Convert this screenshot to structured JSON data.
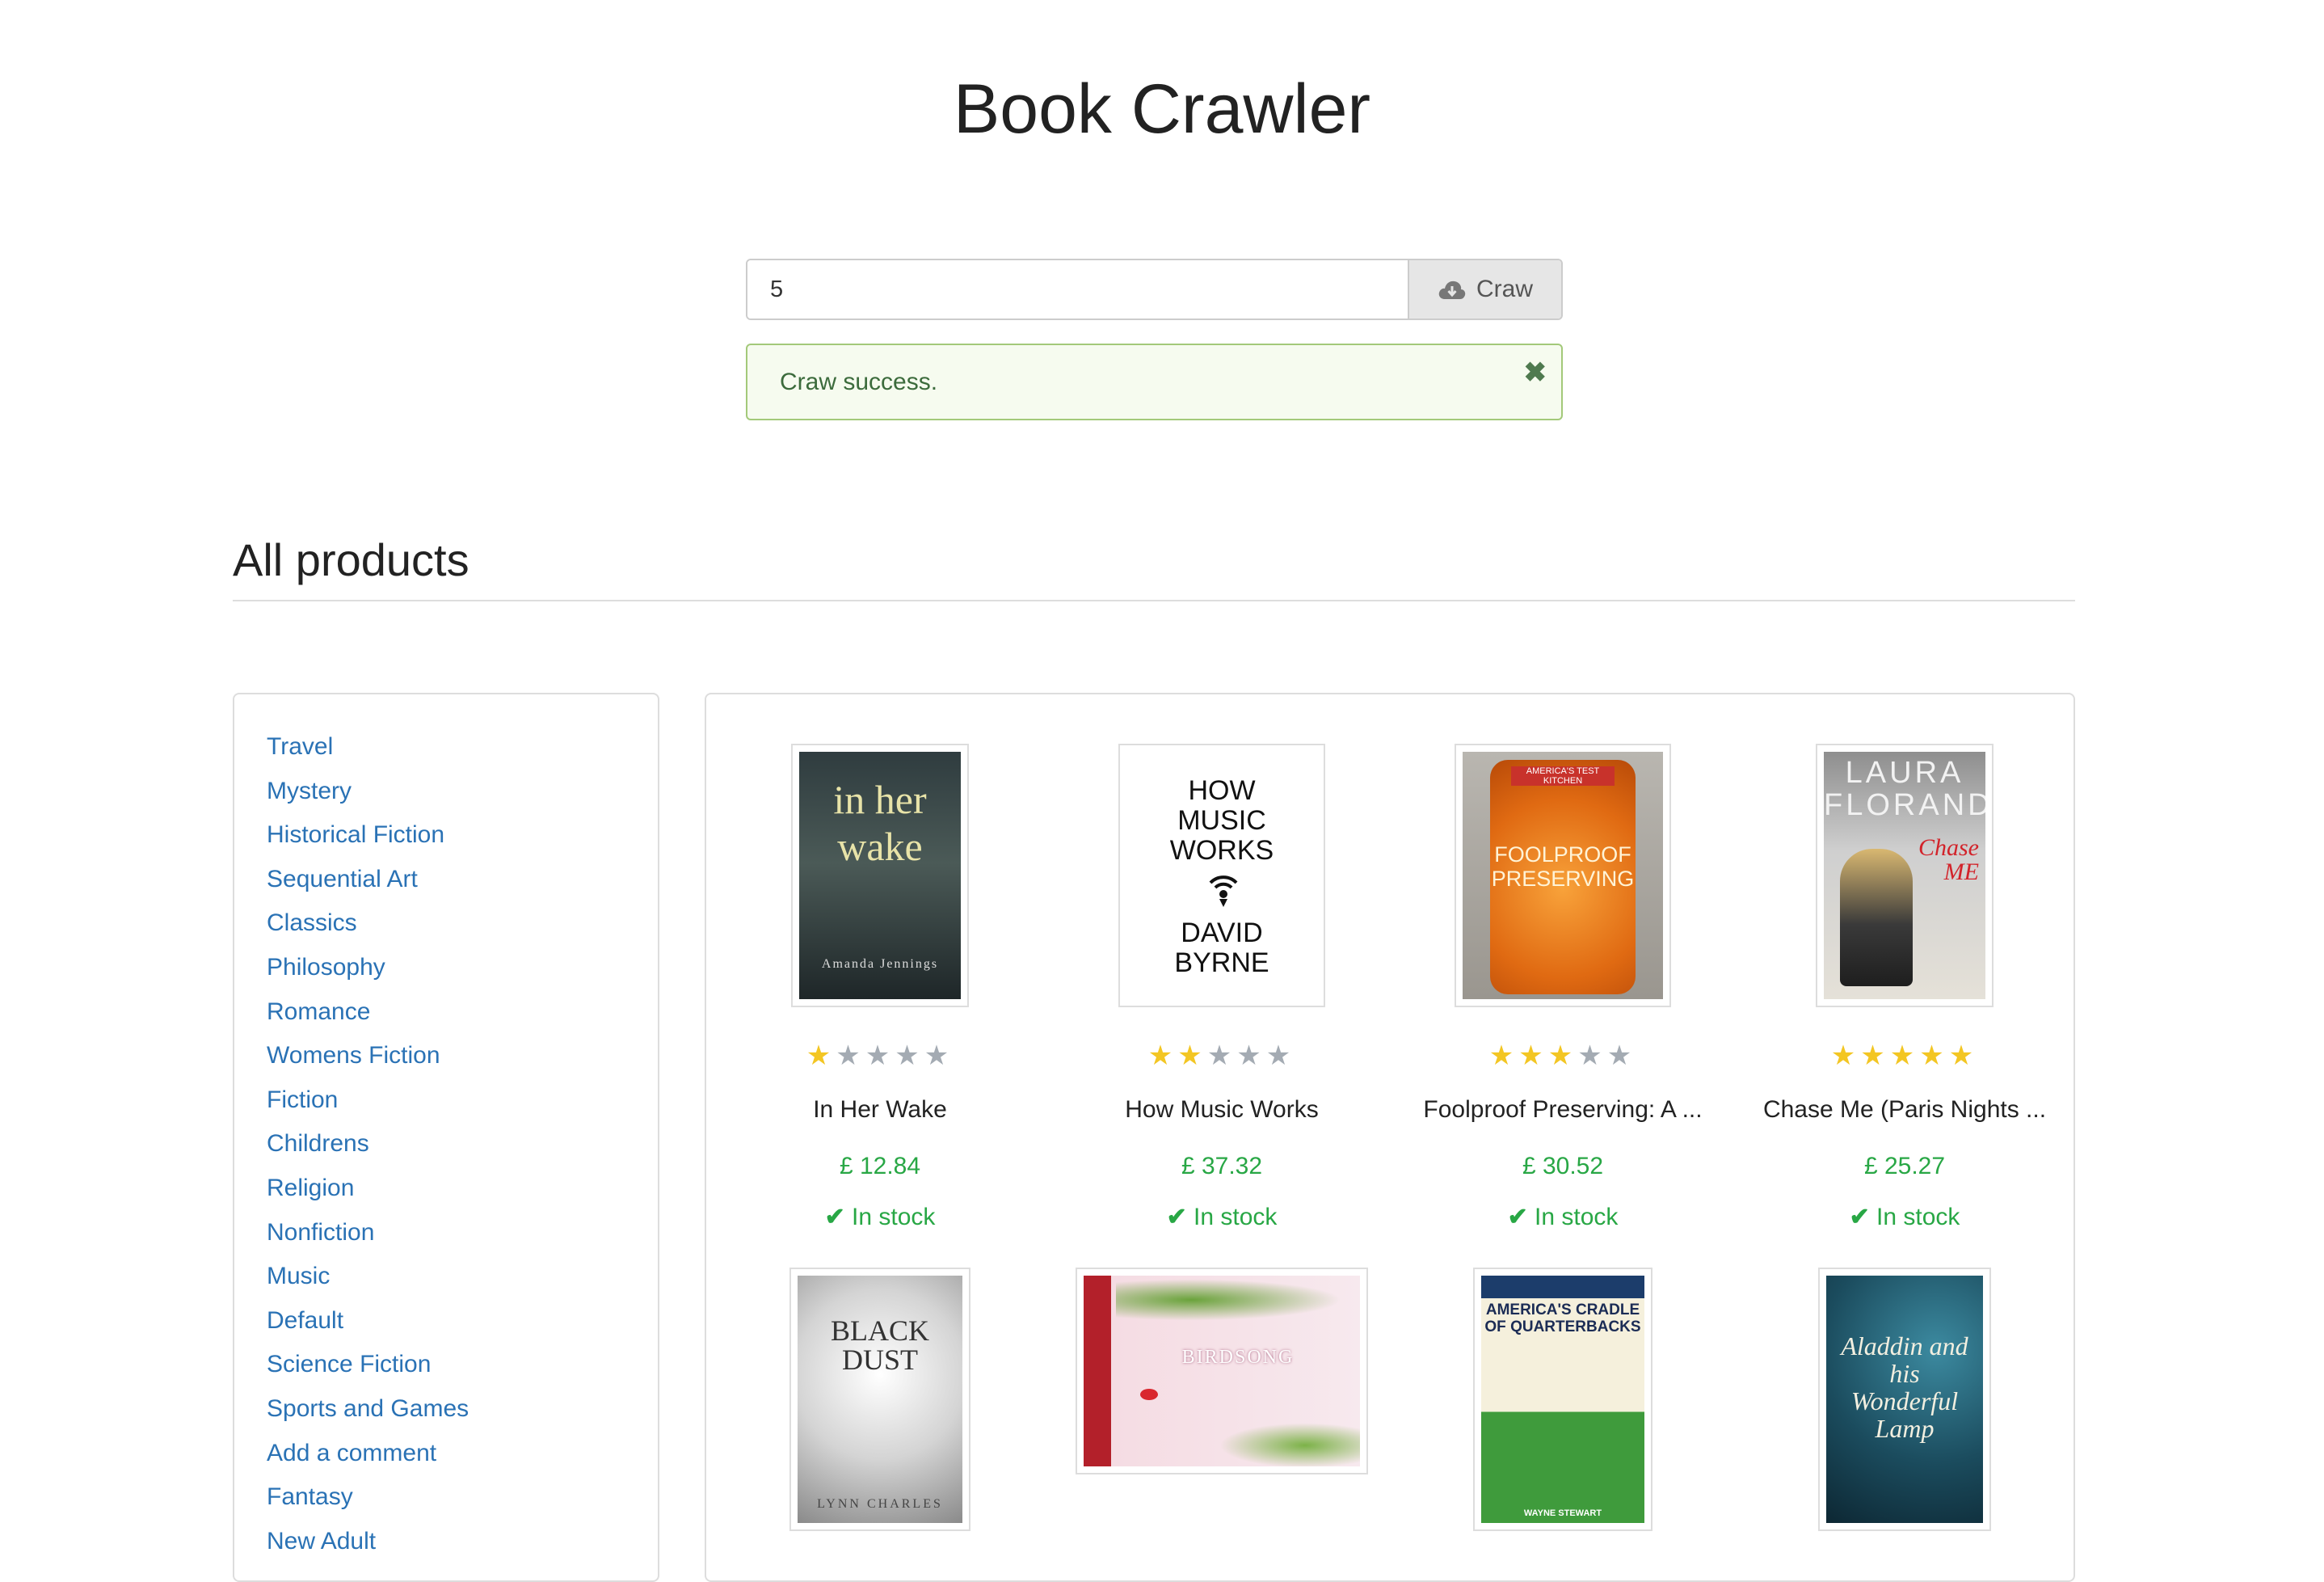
{
  "header": {
    "title": "Book Crawler"
  },
  "crawl": {
    "value": "5",
    "button_label": "Craw",
    "button_icon": "cloud-download-icon"
  },
  "alert": {
    "message": "Craw success.",
    "close_glyph": "✖"
  },
  "section": {
    "title": "All products"
  },
  "categories": [
    "Travel",
    "Mystery",
    "Historical Fiction",
    "Sequential Art",
    "Classics",
    "Philosophy",
    "Romance",
    "Womens Fiction",
    "Fiction",
    "Childrens",
    "Religion",
    "Nonfiction",
    "Music",
    "Default",
    "Science Fiction",
    "Sports and Games",
    "Add a comment",
    "Fantasy",
    "New Adult"
  ],
  "products": [
    {
      "name": "In Her Wake",
      "price": "£ 12.84",
      "stock": "In stock",
      "rating": 1,
      "cover_title": "in her wake",
      "cover_author": "Amanda Jennings"
    },
    {
      "name": "How Music Works",
      "price": "£ 37.32",
      "stock": "In stock",
      "rating": 2,
      "cover_title": "HOW MUSIC WORKS",
      "cover_author": "DAVID BYRNE"
    },
    {
      "name": "Foolproof Preserving: A ...",
      "price": "£ 30.52",
      "stock": "In stock",
      "rating": 3,
      "cover_title": "FOOLPROOF PRESERVING",
      "cover_author": "AMERICA'S TEST KITCHEN"
    },
    {
      "name": "Chase Me (Paris Nights ...",
      "price": "£ 25.27",
      "stock": "In stock",
      "rating": 5,
      "cover_title": "Chase ME",
      "cover_author": "LAURA FLORAND"
    }
  ],
  "products_row2": [
    {
      "cover_title": "BLACK DUST",
      "cover_author": "LYNN CHARLES"
    },
    {
      "cover_title": "BIRDSONG",
      "cover_author": ""
    },
    {
      "cover_title": "AMERICA'S CRADLE OF QUARTERBACKS",
      "cover_author": "WAYNE STEWART"
    },
    {
      "cover_title": "Aladdin and his Wonderful Lamp",
      "cover_author": ""
    }
  ],
  "colors": {
    "link": "#2a72b5",
    "price": "#28a745",
    "star_on": "#f3c623",
    "star_off": "#a4abb3"
  }
}
